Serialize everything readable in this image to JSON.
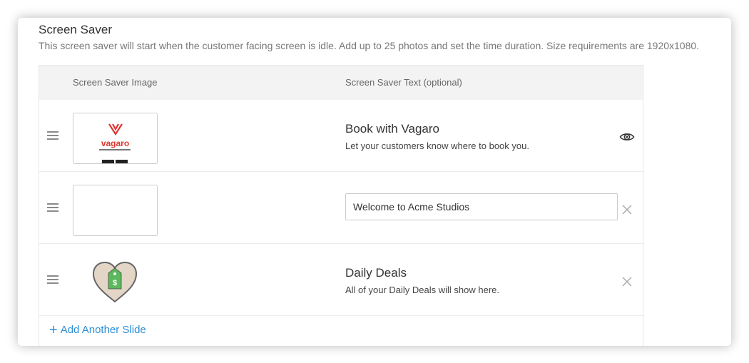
{
  "section": {
    "title": "Screen Saver",
    "description": "This screen saver will start when the customer facing screen is idle. Add up to 25 photos and set the time duration. Size requirements are 1920x1080."
  },
  "table": {
    "col_image": "Screen Saver Image",
    "col_text": "Screen Saver Text (optional)"
  },
  "rows": [
    {
      "image": "vagaro-logo",
      "brand_text": "vagaro",
      "title": "Book with Vagaro",
      "subtitle": "Let your customers know where to book you.",
      "action_icon": "eye-icon"
    },
    {
      "image": "empty-thumbnail",
      "input_value": "Welcome to Acme Studios",
      "action_icon": "close-icon"
    },
    {
      "image": "heart-price-tag",
      "tag_symbol": "$",
      "title": "Daily Deals",
      "subtitle": "All of your Daily Deals will show here.",
      "action_icon": "close-icon"
    }
  ],
  "add_slide": {
    "icon": "plus-icon",
    "label": "Add Another Slide"
  },
  "colors": {
    "accent_link": "#2e8fd6",
    "brand_red": "#e1342f",
    "tag_green": "#5cb85c",
    "heart_fill": "#e3d6c6"
  }
}
